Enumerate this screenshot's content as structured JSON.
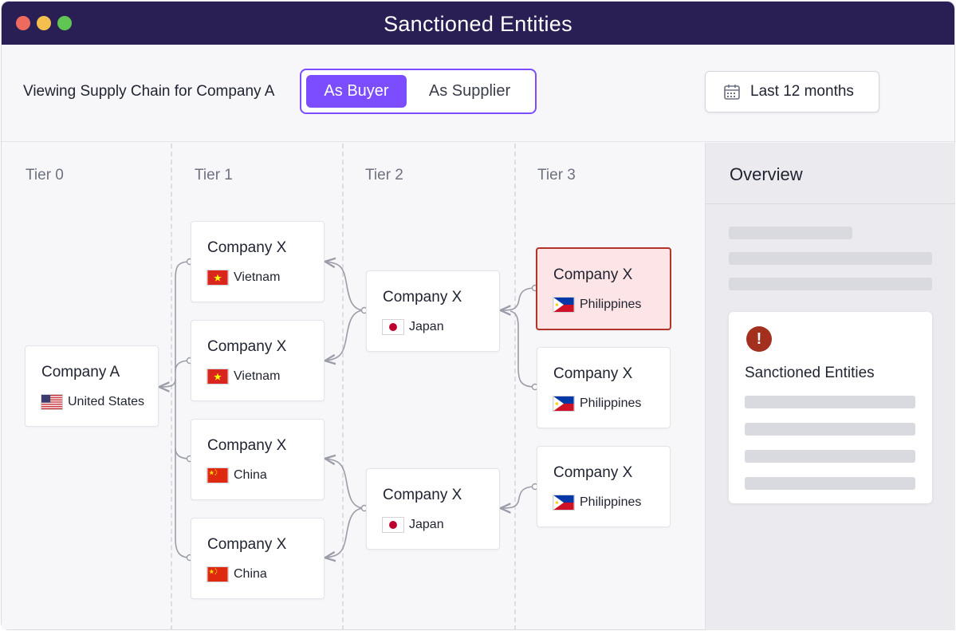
{
  "window": {
    "title": "Sanctioned Entities",
    "traffic_colors": [
      "#ed6a5e",
      "#f4bf4f",
      "#61c554"
    ]
  },
  "toolbar": {
    "viewing_label": "Viewing Supply Chain for Company A",
    "toggle": {
      "active": "As Buyer",
      "inactive": "As Supplier"
    },
    "date_range": {
      "label": "Last 12 months",
      "icon": "calendar-icon"
    }
  },
  "tiers": [
    "Tier 0",
    "Tier 1",
    "Tier 2",
    "Tier 3"
  ],
  "nodes": {
    "t0_a": {
      "name": "Company A",
      "country": "United States",
      "flag": "us"
    },
    "t1_1": {
      "name": "Company X",
      "country": "Vietnam",
      "flag": "vn"
    },
    "t1_2": {
      "name": "Company X",
      "country": "Vietnam",
      "flag": "vn"
    },
    "t1_3": {
      "name": "Company X",
      "country": "China",
      "flag": "cn"
    },
    "t1_4": {
      "name": "Company X",
      "country": "China",
      "flag": "cn"
    },
    "t2_1": {
      "name": "Company X",
      "country": "Japan",
      "flag": "jp"
    },
    "t2_2": {
      "name": "Company X",
      "country": "Japan",
      "flag": "jp"
    },
    "t3_1": {
      "name": "Company X",
      "country": "Philippines",
      "flag": "ph",
      "sanctioned": true
    },
    "t3_2": {
      "name": "Company X",
      "country": "Philippines",
      "flag": "ph"
    },
    "t3_3": {
      "name": "Company X",
      "country": "Philippines",
      "flag": "ph"
    }
  },
  "sidebar": {
    "title": "Overview",
    "alert": {
      "title": "Sanctioned Entities",
      "icon": "exclamation-icon",
      "color": "#a3301f"
    }
  },
  "colors": {
    "accent": "#7c4dff",
    "titlebar": "#2a1f55",
    "sanctioned_bg": "#fde4e6",
    "sanctioned_border": "#b2352a",
    "connector": "#9a9ca8"
  }
}
